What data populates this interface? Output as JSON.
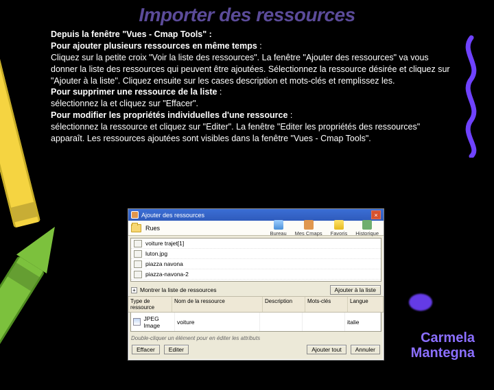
{
  "slide": {
    "title": "Importer des ressources",
    "author_line1": "Carmela",
    "author_line2": "Mantegna"
  },
  "text": {
    "p1_bold": "Depuis la fenêtre \"Vues - Cmap Tools\" :",
    "p2_bold": "Pour ajouter plusieurs ressources en même temps",
    "p2_tail": " :",
    "p3": "Cliquez sur la petite croix \"Voir la liste des ressources\". La fenêtre \"Ajouter des ressources\" va vous donner la liste des ressources qui peuvent être ajoutées. Sélectionnez la ressource désirée et cliquez sur \"Ajouter à la liste\". Cliquez ensuite sur les cases description et mots-clés et remplissez les.",
    "p4_bold": "Pour supprimer une ressource de la liste",
    "p4_tail": " :",
    "p5": "sélectionnez la et cliquez sur \"Effacer\".",
    "p6_bold": "Pour modifier les propriétés individuelles d'une ressource",
    "p6_tail": " :",
    "p7": "sélectionnez la ressource et cliquez sur \"Editer\". La fenêtre \"Editer les propriétés des ressources\" apparaît. Les ressources ajoutées sont visibles dans la fenêtre \"Vues - Cmap Tools\"."
  },
  "dialog": {
    "title": "Ajouter des ressources",
    "folder": "Rues",
    "tbtn_desktop": "Bureau",
    "tbtn_mycmap": "Mes Cmaps",
    "tbtn_fav": "Favoris",
    "tbtn_hist": "Historique",
    "files": [
      "voiture trajet[1]",
      "luton.jpg",
      "piazza navona",
      "piazza-navona-2"
    ],
    "expand_label": "Montrer la liste de ressources",
    "add_btn": "Ajouter à la liste",
    "col_type": "Type de ressource",
    "col_name": "Nom de la ressource",
    "col_desc": "Description",
    "col_keywords": "Mots-clés",
    "col_lang": "Langue",
    "row_type": "JPEG Image",
    "row_name": "voiture",
    "row_lang": "italie",
    "hint": "Double-cliquer un élément pour en éditer les attributs",
    "btn_remove": "Effacer",
    "btn_edit": "Editer",
    "btn_addall": "Ajouter tout",
    "btn_cancel": "Annuler"
  }
}
